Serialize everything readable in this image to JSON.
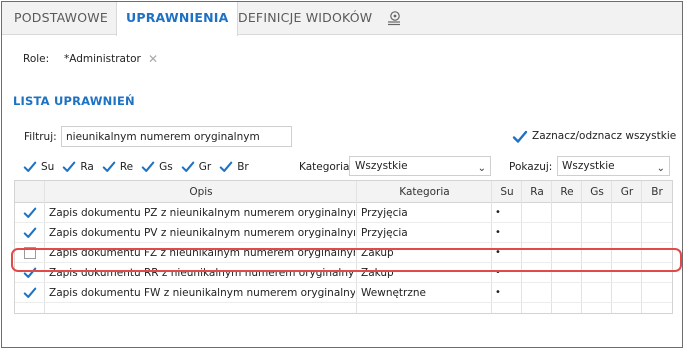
{
  "tabs": [
    {
      "label": "PODSTAWOWE",
      "active": false
    },
    {
      "label": "UPRAWNIENIA",
      "active": true
    },
    {
      "label": "DEFINICJE WIDOKÓW",
      "active": false
    }
  ],
  "tab_icon": "settings-list-icon",
  "role": {
    "label": "Role:",
    "value": "*Administrator",
    "clear_icon": "close-icon"
  },
  "section_title": "LISTA UPRAWNIEŃ",
  "filter": {
    "label": "Filtruj:",
    "value": "nieunikalnym numerem oryginalnym"
  },
  "select_all": {
    "label": "Zaznacz/odznacz wszystkie",
    "checked": true
  },
  "checkbox_filters": [
    {
      "label": "Su",
      "checked": true
    },
    {
      "label": "Ra",
      "checked": true
    },
    {
      "label": "Re",
      "checked": true
    },
    {
      "label": "Gs",
      "checked": true
    },
    {
      "label": "Gr",
      "checked": true
    },
    {
      "label": "Br",
      "checked": true
    }
  ],
  "kategoria": {
    "label": "Kategoria:",
    "value": "Wszystkie"
  },
  "pokazuj": {
    "label": "Pokazuj:",
    "value": "Wszystkie"
  },
  "columns": [
    "Opis",
    "Kategoria",
    "Su",
    "Ra",
    "Re",
    "Gs",
    "Gr",
    "Br"
  ],
  "rows": [
    {
      "checked": true,
      "opis": "Zapis dokumentu PZ z nieunikalnym numerem oryginalnym",
      "kategoria": "Przyjęcia",
      "su": "•"
    },
    {
      "checked": true,
      "opis": "Zapis dokumentu PV z nieunikalnym numerem oryginalnym",
      "kategoria": "Przyjęcia",
      "su": "•"
    },
    {
      "checked": false,
      "opis": "Zapis dokumentu FZ z nieunikalnym numerem oryginalnym",
      "kategoria": "Zakup",
      "su": "•"
    },
    {
      "checked": true,
      "opis": "Zapis dokumentu RR z nieunikalnym numerem oryginalnym",
      "kategoria": "Zakup",
      "su": "•"
    },
    {
      "checked": true,
      "opis": "Zapis dokumentu FW z nieunikalnym numerem oryginalnym",
      "kategoria": "Wewnętrzne",
      "su": "•"
    }
  ],
  "colors": {
    "accent": "#1e72c4",
    "highlight": "#e24a4a"
  }
}
